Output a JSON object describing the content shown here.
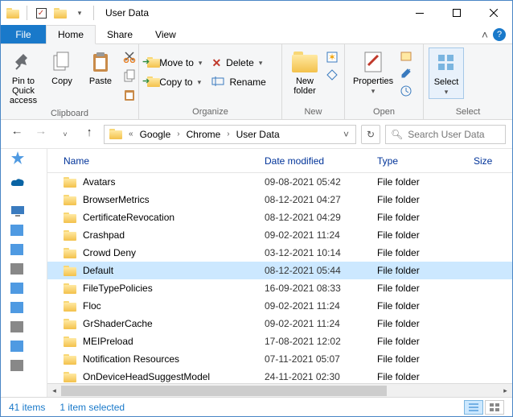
{
  "window": {
    "title": "User Data"
  },
  "tabs": {
    "file": "File",
    "home": "Home",
    "share": "Share",
    "view": "View"
  },
  "ribbon": {
    "clipboard": {
      "label": "Clipboard",
      "pin": "Pin to Quick\naccess",
      "copy": "Copy",
      "paste": "Paste"
    },
    "organize": {
      "label": "Organize",
      "moveto": "Move to",
      "copyto": "Copy to",
      "delete": "Delete",
      "rename": "Rename"
    },
    "new": {
      "label": "New",
      "newfolder": "New\nfolder"
    },
    "open": {
      "label": "Open",
      "properties": "Properties"
    },
    "select": {
      "label": "Select",
      "select": "Select"
    }
  },
  "breadcrumbs": [
    "Google",
    "Chrome",
    "User Data"
  ],
  "search": {
    "placeholder": "Search User Data"
  },
  "columns": {
    "name": "Name",
    "date": "Date modified",
    "type": "Type",
    "size": "Size"
  },
  "items": [
    {
      "name": "Avatars",
      "date": "09-08-2021 05:42",
      "type": "File folder",
      "selected": false
    },
    {
      "name": "BrowserMetrics",
      "date": "08-12-2021 04:27",
      "type": "File folder",
      "selected": false
    },
    {
      "name": "CertificateRevocation",
      "date": "08-12-2021 04:29",
      "type": "File folder",
      "selected": false
    },
    {
      "name": "Crashpad",
      "date": "09-02-2021 11:24",
      "type": "File folder",
      "selected": false
    },
    {
      "name": "Crowd Deny",
      "date": "03-12-2021 10:14",
      "type": "File folder",
      "selected": false
    },
    {
      "name": "Default",
      "date": "08-12-2021 05:44",
      "type": "File folder",
      "selected": true
    },
    {
      "name": "FileTypePolicies",
      "date": "16-09-2021 08:33",
      "type": "File folder",
      "selected": false
    },
    {
      "name": "Floc",
      "date": "09-02-2021 11:24",
      "type": "File folder",
      "selected": false
    },
    {
      "name": "GrShaderCache",
      "date": "09-02-2021 11:24",
      "type": "File folder",
      "selected": false
    },
    {
      "name": "MEIPreload",
      "date": "17-08-2021 12:02",
      "type": "File folder",
      "selected": false
    },
    {
      "name": "Notification Resources",
      "date": "07-11-2021 05:07",
      "type": "File folder",
      "selected": false
    },
    {
      "name": "OnDeviceHeadSuggestModel",
      "date": "24-11-2021 02:30",
      "type": "File folder",
      "selected": false
    }
  ],
  "status": {
    "count": "41 items",
    "selected": "1 item selected"
  }
}
